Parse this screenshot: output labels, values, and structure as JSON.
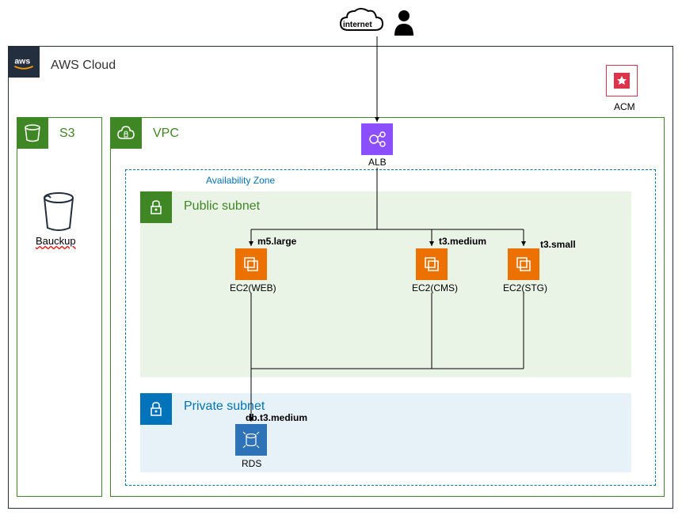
{
  "internet_label": "internet",
  "aws_cloud": "AWS Cloud",
  "acm": "ACM",
  "s3": {
    "title": "S3",
    "backup": "Bauckup"
  },
  "vpc": "VPC",
  "alb": "ALB",
  "az": "Availability Zone",
  "public_subnet": "Public subnet",
  "private_subnet": "Private subnet",
  "ec2": {
    "web": {
      "type": "m5.large",
      "name": "EC2(WEB)"
    },
    "cms": {
      "type": "t3.medium",
      "name": "EC2(CMS)"
    },
    "stg": {
      "type": "t3.small",
      "name": "EC2(STG)"
    }
  },
  "rds": {
    "type": "db.t3.medium",
    "name": "RDS"
  }
}
